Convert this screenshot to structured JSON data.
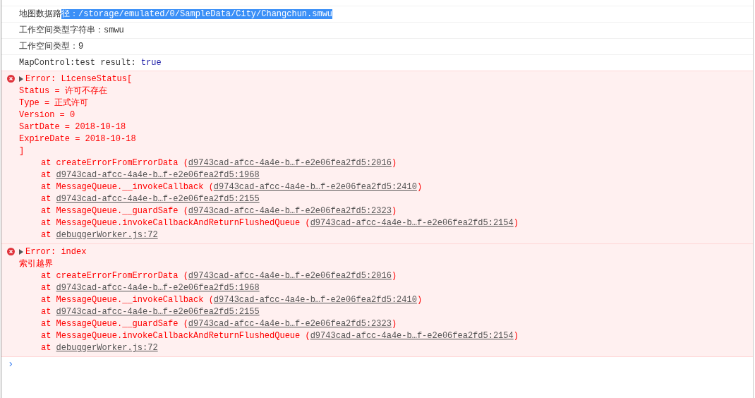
{
  "messages": [
    {
      "kind": "log",
      "segments": [
        {
          "text": "地图数据路",
          "kind": "text"
        },
        {
          "text": "径：/storage/emulated/0/SampleData/City/Changchun.smwu",
          "kind": "selection"
        }
      ]
    },
    {
      "kind": "log",
      "segments": [
        {
          "text": "工作空间类型字符串：smwu",
          "kind": "text"
        }
      ]
    },
    {
      "kind": "log",
      "segments": [
        {
          "text": "工作空间类型：9",
          "kind": "text"
        }
      ]
    },
    {
      "kind": "log",
      "segments": [
        {
          "text": "MapControl:test result: ",
          "kind": "text"
        },
        {
          "text": "true",
          "kind": "boolean"
        }
      ]
    },
    {
      "kind": "error",
      "expanded": false,
      "lines": [
        "Error: LicenseStatus[",
        "Status = 许可不存在",
        "Type = 正式许可",
        "Version = 0",
        "SartDate = 2018-10-18",
        "ExpireDate = 2018-10-18",
        "]"
      ],
      "stack": [
        {
          "prefix": "at createErrorFromErrorData (",
          "link": "d9743cad-afcc-4a4e-b…f-e2e06fea2fd5:2016",
          "suffix": ")"
        },
        {
          "prefix": "at ",
          "link": "d9743cad-afcc-4a4e-b…f-e2e06fea2fd5:1968"
        },
        {
          "prefix": "at MessageQueue.__invokeCallback (",
          "link": "d9743cad-afcc-4a4e-b…f-e2e06fea2fd5:2410",
          "suffix": ")"
        },
        {
          "prefix": "at ",
          "link": "d9743cad-afcc-4a4e-b…f-e2e06fea2fd5:2155"
        },
        {
          "prefix": "at MessageQueue.__guardSafe (",
          "link": "d9743cad-afcc-4a4e-b…f-e2e06fea2fd5:2323",
          "suffix": ")"
        },
        {
          "prefix": "at MessageQueue.invokeCallbackAndReturnFlushedQueue (",
          "link": "d9743cad-afcc-4a4e-b…f-e2e06fea2fd5:2154",
          "suffix": ")"
        },
        {
          "prefix": "at ",
          "link": "debuggerWorker.js:72"
        }
      ]
    },
    {
      "kind": "error",
      "expanded": false,
      "lines": [
        "Error: index",
        "索引越界"
      ],
      "stack": [
        {
          "prefix": "at createErrorFromErrorData (",
          "link": "d9743cad-afcc-4a4e-b…f-e2e06fea2fd5:2016",
          "suffix": ")"
        },
        {
          "prefix": "at ",
          "link": "d9743cad-afcc-4a4e-b…f-e2e06fea2fd5:1968"
        },
        {
          "prefix": "at MessageQueue.__invokeCallback (",
          "link": "d9743cad-afcc-4a4e-b…f-e2e06fea2fd5:2410",
          "suffix": ")"
        },
        {
          "prefix": "at ",
          "link": "d9743cad-afcc-4a4e-b…f-e2e06fea2fd5:2155"
        },
        {
          "prefix": "at MessageQueue.__guardSafe (",
          "link": "d9743cad-afcc-4a4e-b…f-e2e06fea2fd5:2323",
          "suffix": ")"
        },
        {
          "prefix": "at MessageQueue.invokeCallbackAndReturnFlushedQueue (",
          "link": "d9743cad-afcc-4a4e-b…f-e2e06fea2fd5:2154",
          "suffix": ")"
        },
        {
          "prefix": "at ",
          "link": "debuggerWorker.js:72"
        }
      ]
    }
  ],
  "prompt": {
    "symbol": "›"
  }
}
